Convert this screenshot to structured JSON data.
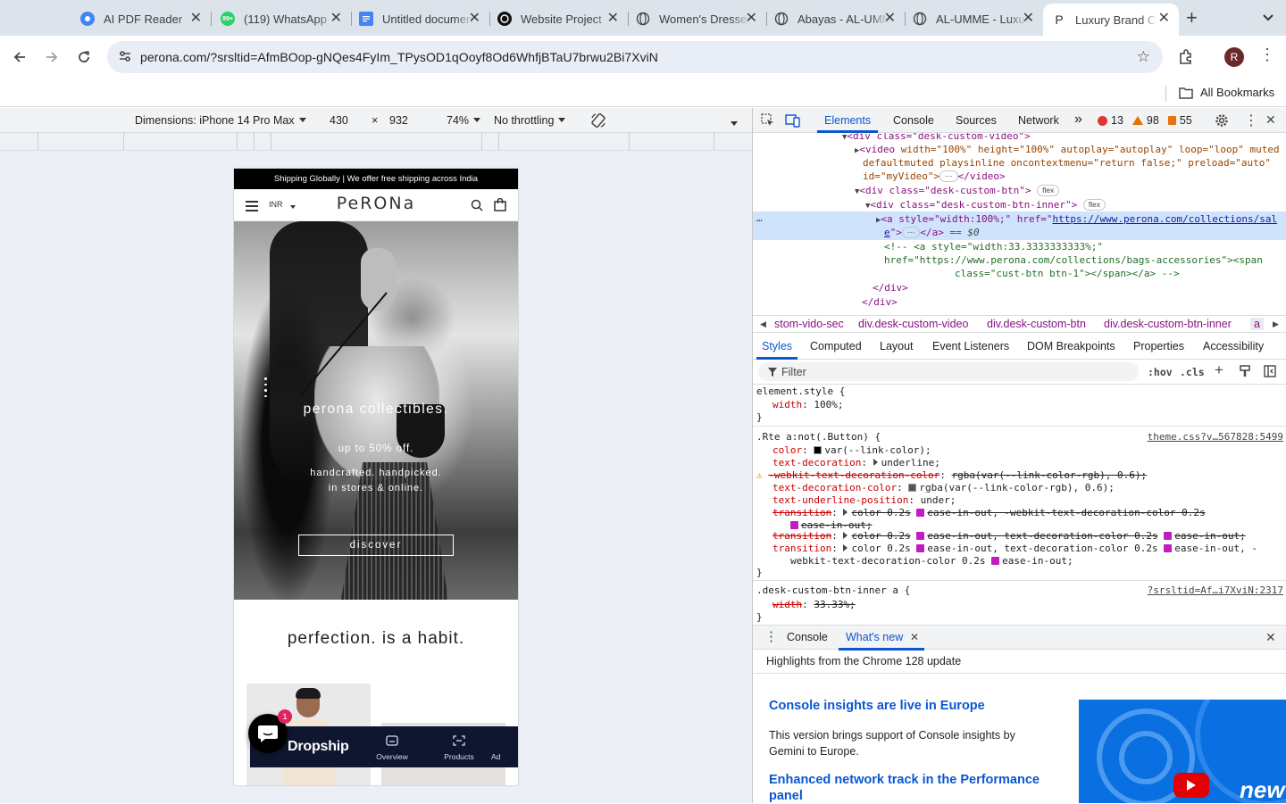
{
  "browser": {
    "tabs": [
      {
        "title": "AI PDF Reader",
        "icon": "ai-pdf-icon",
        "color": "#4285f4"
      },
      {
        "title": "(119) WhatsApp",
        "icon": "whatsapp-icon",
        "color": "#25d366",
        "badge": "99+"
      },
      {
        "title": "Untitled document",
        "icon": "docs-icon",
        "color": "#4285f4"
      },
      {
        "title": "Website Project",
        "icon": "chatgpt-icon",
        "color": "#111111"
      },
      {
        "title": "Women's Dresses",
        "icon": "globe-icon",
        "color": "#5f6368"
      },
      {
        "title": "Abayas - AL-UMME",
        "icon": "globe-icon",
        "color": "#5f6368"
      },
      {
        "title": "AL-UMME - Luxury",
        "icon": "globe-icon",
        "color": "#5f6368"
      },
      {
        "title": "Luxury Brand Clothing",
        "icon": "perona-icon",
        "color": "#5f6368",
        "active": true
      }
    ],
    "url": "perona.com/?srsltid=AfmBOop-gNQes4FyIm_TPysOD1qOoyf8Od6WhfjBTaU7brwu2Bi7XviN",
    "profile_initial": "R",
    "bookmarks_label": "All Bookmarks"
  },
  "device_toolbar": {
    "dimensions_label": "Dimensions: iPhone 14 Pro Max",
    "width": "430",
    "times": "×",
    "height": "932",
    "zoom": "74%",
    "throttling": "No throttling"
  },
  "site": {
    "announcement": "Shipping Globally | We offer free shipping across India",
    "currency": "INR",
    "logo": "PeRONa",
    "hero_title": "perona collectibles.",
    "hero_sub1": "up to 50% off.",
    "hero_sub2a": "handcrafted. handpicked.",
    "hero_sub2b": "in stores & online.",
    "cta": "discover",
    "tagline": "perfection. is a habit.",
    "dropship": {
      "title": "Dropship",
      "tabs": [
        "Overview",
        "Products",
        "Ad"
      ],
      "badge": "1"
    }
  },
  "devtools": {
    "tabs": [
      "Elements",
      "Console",
      "Sources",
      "Network"
    ],
    "more": "»",
    "errors": "13",
    "warnings": "98",
    "issues": "55",
    "dom": {
      "l1_tag": "<div class=\"desk-custom-video\">",
      "l2a": "<video ",
      "l2_attrs": "width=\"100%\" height=\"100%\" autoplay=\"autoplay\" loop=\"loop\" muted",
      "l3": "defaultmuted playsinline oncontextmenu=\"return false;\" preload=\"auto\"",
      "l4": "id=\"myVideo\">",
      "l4_end": "</video>",
      "l5": "<div class=\"desk-custom-btn\">",
      "l6": "<div class=\"desk-custom-btn-inner\">",
      "flex": "flex",
      "l7a": "<a style=\"width:100%;\" href=\"",
      "l7_href1": "https://www.perona.com/collections/sal",
      "l8_href2": "e",
      "l8_rest": "\">",
      "l8_close": "</a>",
      "l8_eq": "== $0",
      "l9": "<!-- <a style=\"width:33.3333333333%;\"",
      "l10": "href=\"https://www.perona.com/collections/bags-accessories\"><span",
      "l11": "class=\"cust-btn btn-1\"></span></a> -->",
      "l12": "</div>",
      "l13": "</div>",
      "ellipsis": "…",
      "dots": "⋯"
    },
    "breadcrumbs": [
      "stom-vido-sec",
      "div.desk-custom-video",
      "div.desk-custom-btn",
      "div.desk-custom-btn-inner",
      "a"
    ],
    "subtabs": [
      "Styles",
      "Computed",
      "Layout",
      "Event Listeners",
      "DOM Breakpoints",
      "Properties",
      "Accessibility"
    ],
    "filter_placeholder": "Filter",
    "hov": ":hov",
    "cls": ".cls",
    "styles": {
      "r1_sel": "element.style {",
      "r1_p": "width",
      "r1_v": "100%;",
      "close": "}",
      "r2_sel": ".Rte a:not(.Button) {",
      "r2_src": "theme.css?v…567828:5499",
      "r2_color_p": "color",
      "r2_color_v": "var(--link-color);",
      "r2_td_p": "text-decoration",
      "r2_td_v": "underline;",
      "r2_wk_p": "-webkit-text-decoration-color",
      "r2_wk_v": "rgba(var(--link-color-rgb), 0.6);",
      "r2_tdc_p": "text-decoration-color",
      "r2_tdc_v": "rgba(var(--link-color-rgb), 0.6);",
      "r2_tup_p": "text-underline-position",
      "r2_tup_v": "under;",
      "tr_p": "transition",
      "tr1_a": "color 0.2s",
      "tr1_b": "ease-in-out, -webkit-text-decoration-color 0.2s",
      "tr1_c": "ease-in-out;",
      "tr2_a": "color 0.2s",
      "tr2_b": "ease-in-out, text-decoration-color 0.2s",
      "tr2_c": "ease-in-out;",
      "tr3_a": "color 0.2s",
      "tr3_b": "ease-in-out, text-decoration-color 0.2s",
      "tr3_c": "ease-in-out, -",
      "tr3_d": "webkit-text-decoration-color 0.2s",
      "tr3_e": "ease-in-out;",
      "r3_sel": ".desk-custom-btn-inner a {",
      "r3_src": "?srsltid=Af…i7XviN:2317",
      "r3_p": "width",
      "r3_v": "33.33%;"
    },
    "drawer": {
      "tabs": [
        "Console",
        "What's new"
      ],
      "highlights": "Highlights from the Chrome 128 update",
      "h1": "Console insights are live in Europe",
      "p1": "This version brings support of Console insights by Gemini to Europe.",
      "h2": "Enhanced network track in the Performance panel",
      "video_text": "new"
    },
    "colors": {
      "accent": "#0b57d0",
      "error": "#dc362e",
      "warning": "#e37400",
      "issue": "#e8710a"
    }
  }
}
